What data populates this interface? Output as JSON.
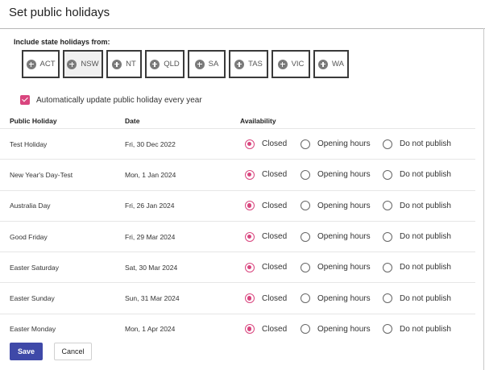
{
  "dialog": {
    "title": "Set public holidays"
  },
  "states": {
    "label": "Include state holidays from:",
    "buttons": [
      {
        "label": "ACT",
        "active": false
      },
      {
        "label": "NSW",
        "active": true
      },
      {
        "label": "NT",
        "active": false
      },
      {
        "label": "QLD",
        "active": false
      },
      {
        "label": "SA",
        "active": false
      },
      {
        "label": "TAS",
        "active": false
      },
      {
        "label": "VIC",
        "active": false
      },
      {
        "label": "WA",
        "active": false
      }
    ]
  },
  "auto_update": {
    "label": "Automatically update public holiday every year",
    "checked": true
  },
  "table": {
    "headers": {
      "holiday": "Public Holiday",
      "date": "Date",
      "availability": "Availability"
    },
    "options": [
      "Closed",
      "Opening hours",
      "Do not publish"
    ],
    "rows": [
      {
        "name": "Test Holiday",
        "date": "Fri, 30 Dec 2022",
        "selected": "Closed"
      },
      {
        "name": "New Year's Day-Test",
        "date": "Mon, 1 Jan 2024",
        "selected": "Closed"
      },
      {
        "name": "Australia Day",
        "date": "Fri, 26 Jan 2024",
        "selected": "Closed"
      },
      {
        "name": "Good Friday",
        "date": "Fri, 29 Mar 2024",
        "selected": "Closed"
      },
      {
        "name": "Easter Saturday",
        "date": "Sat, 30 Mar 2024",
        "selected": "Closed"
      },
      {
        "name": "Easter Sunday",
        "date": "Sun, 31 Mar 2024",
        "selected": "Closed"
      },
      {
        "name": "Easter Monday",
        "date": "Mon, 1 Apr 2024",
        "selected": "Closed"
      }
    ]
  },
  "actions": {
    "save_label": "Save",
    "cancel_label": "Cancel"
  },
  "colors": {
    "accent": "#d9457e",
    "primary_button": "#3f49a8"
  },
  "icons": {
    "state_button_icon": "plus-circle-icon",
    "checkbox_icon": "checkmark-icon"
  }
}
